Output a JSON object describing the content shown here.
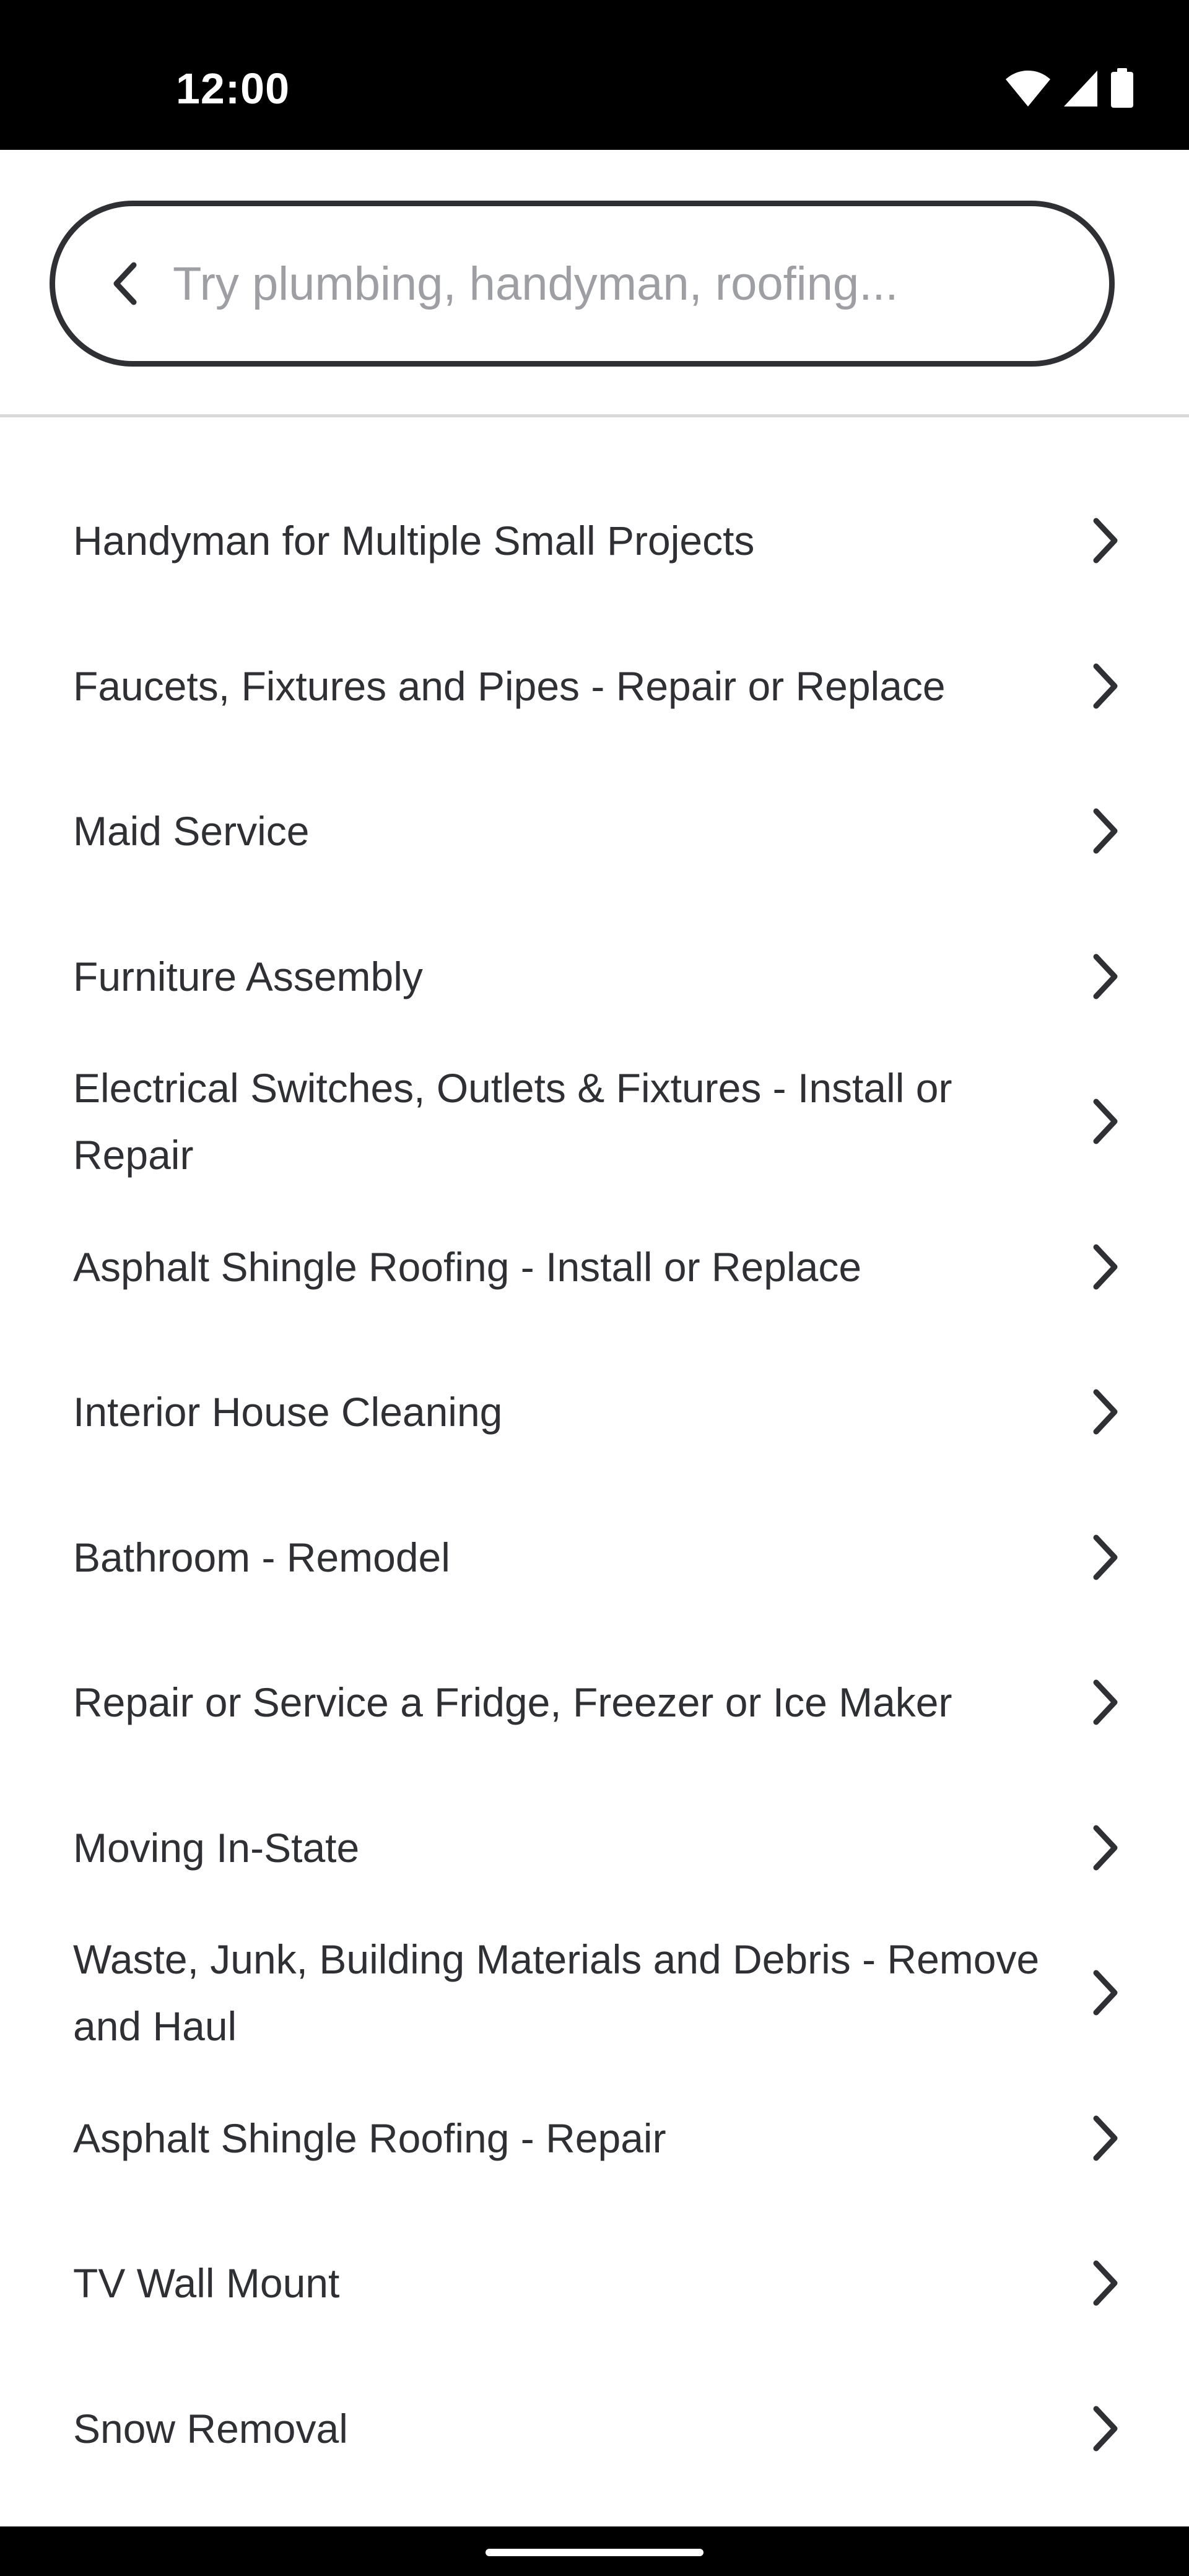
{
  "status_bar": {
    "time": "12:00",
    "icons": [
      "wifi-icon",
      "cellular-signal-icon",
      "battery-icon"
    ]
  },
  "search": {
    "placeholder": "Try plumbing, handyman, roofing...",
    "value": "",
    "back_icon": "chevron-left-icon"
  },
  "categories": [
    {
      "label": "Handyman for Multiple Small Projects"
    },
    {
      "label": "Faucets, Fixtures and Pipes - Repair or Replace"
    },
    {
      "label": "Maid Service"
    },
    {
      "label": "Furniture Assembly"
    },
    {
      "label": "Electrical Switches, Outlets & Fixtures - Install or Repair"
    },
    {
      "label": "Asphalt Shingle Roofing - Install or Replace"
    },
    {
      "label": "Interior House Cleaning"
    },
    {
      "label": "Bathroom - Remodel"
    },
    {
      "label": "Repair or Service a Fridge, Freezer or Ice Maker"
    },
    {
      "label": "Moving In-State"
    },
    {
      "label": "Waste, Junk, Building Materials and Debris - Remove and Haul"
    },
    {
      "label": "Asphalt Shingle Roofing - Repair"
    },
    {
      "label": "TV Wall Mount"
    },
    {
      "label": "Snow Removal"
    }
  ],
  "item_icon": "chevron-right-icon",
  "colors": {
    "text": "#2f3033",
    "placeholder": "#9e9fa3",
    "divider": "#d9d9db",
    "system_bar": "#000000"
  }
}
